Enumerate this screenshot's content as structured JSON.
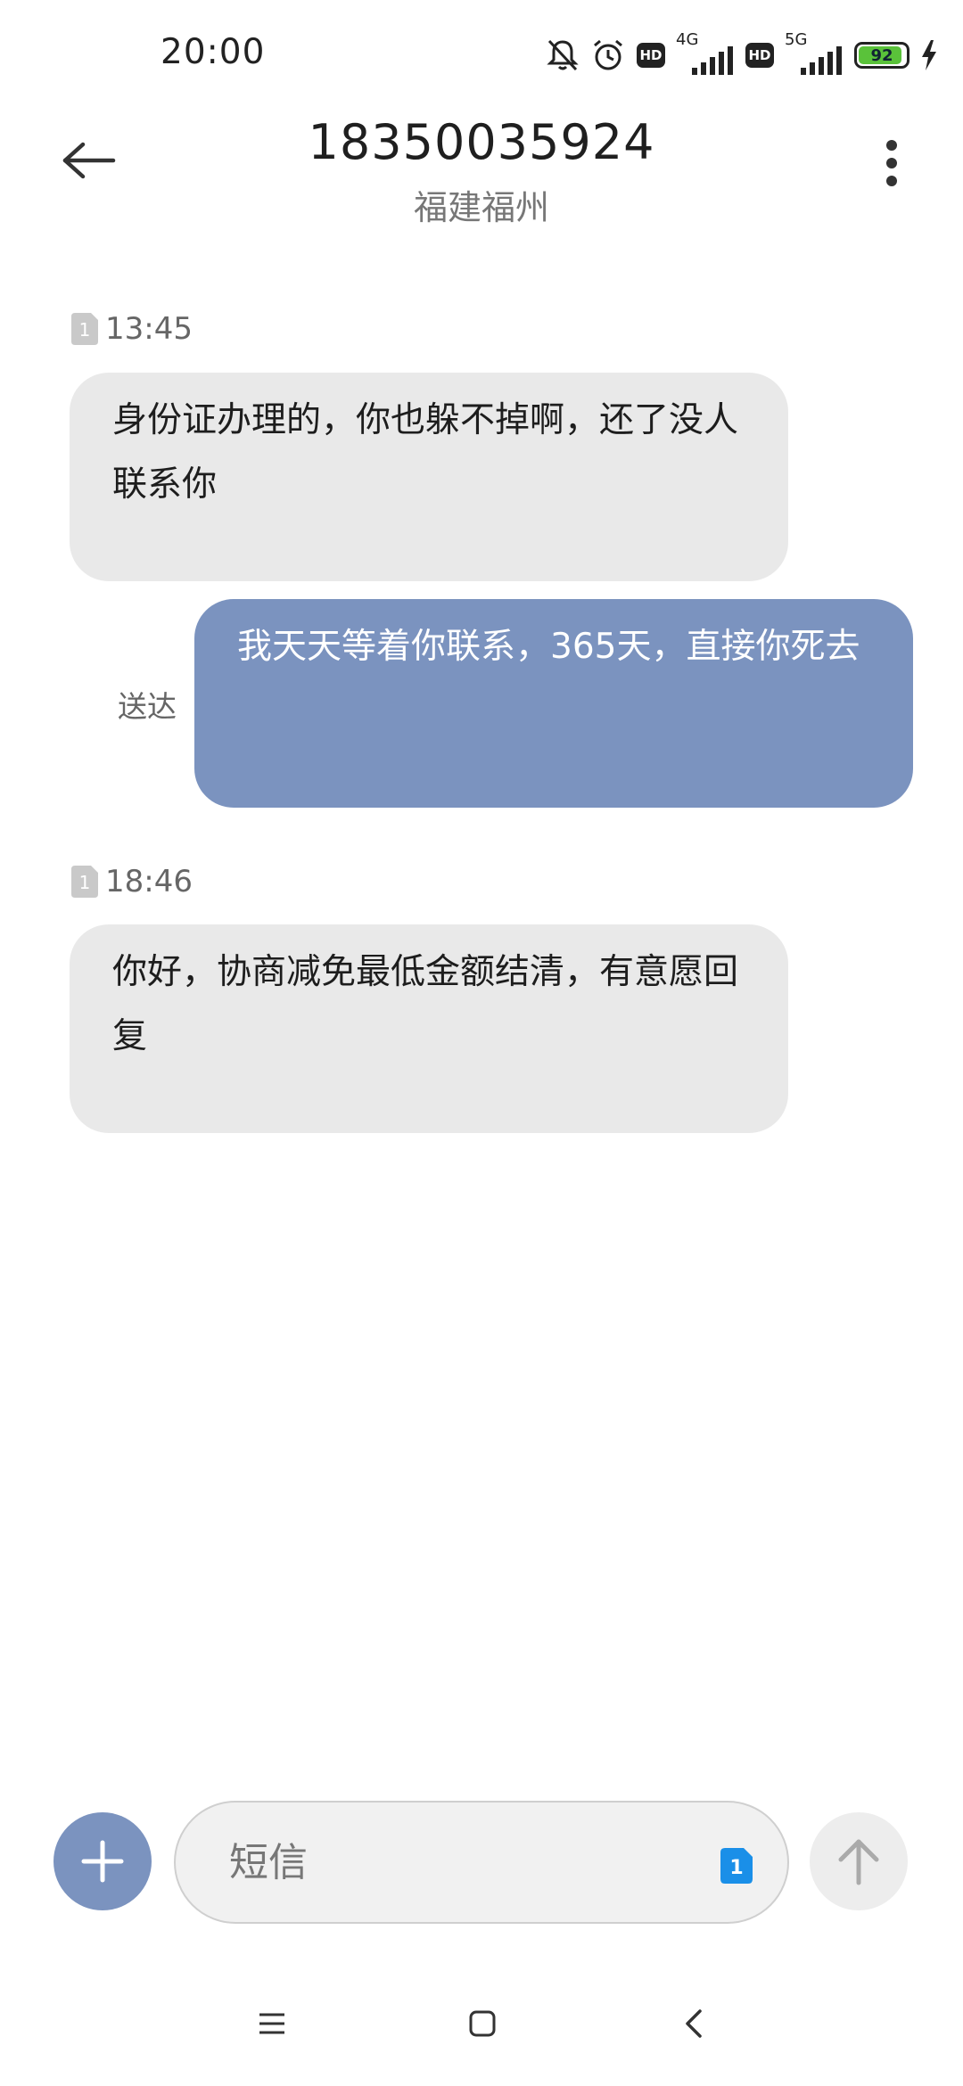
{
  "status_bar": {
    "time": "20:00",
    "icons": [
      "mute-icon",
      "alarm-icon",
      "hd-badge",
      "signal-4g-icon",
      "hd-badge",
      "signal-5g-icon",
      "battery-icon",
      "charging-icon"
    ],
    "hd_label": "HD",
    "net1": "4G",
    "net2": "5G",
    "battery_level": 92,
    "battery_text": "92",
    "battery_color": "#5ac23a"
  },
  "header": {
    "title": "18350035924",
    "subtitle": "福建福州"
  },
  "messages": [
    {
      "direction": "incoming",
      "sim": "1",
      "time": "13:45",
      "text": "身份证办理的，你也躲不掉啊，还了没人联系你"
    },
    {
      "direction": "outgoing",
      "status": "送达",
      "text": "我天天等着你联系，365天，直接你死去"
    },
    {
      "direction": "incoming",
      "sim": "1",
      "time": "18:46",
      "text": "你好，协商减免最低金额结清，有意愿回复"
    }
  ],
  "composer": {
    "placeholder": "短信",
    "sim_label": "1"
  },
  "colors": {
    "incoming_bubble": "#e9e9e9",
    "outgoing_bubble": "#7b93bf",
    "accent": "#7b93bf",
    "sim_blue": "#1a8fe8"
  },
  "nav_bar": {
    "icons": [
      "menu-icon",
      "home-icon",
      "back-icon"
    ]
  }
}
